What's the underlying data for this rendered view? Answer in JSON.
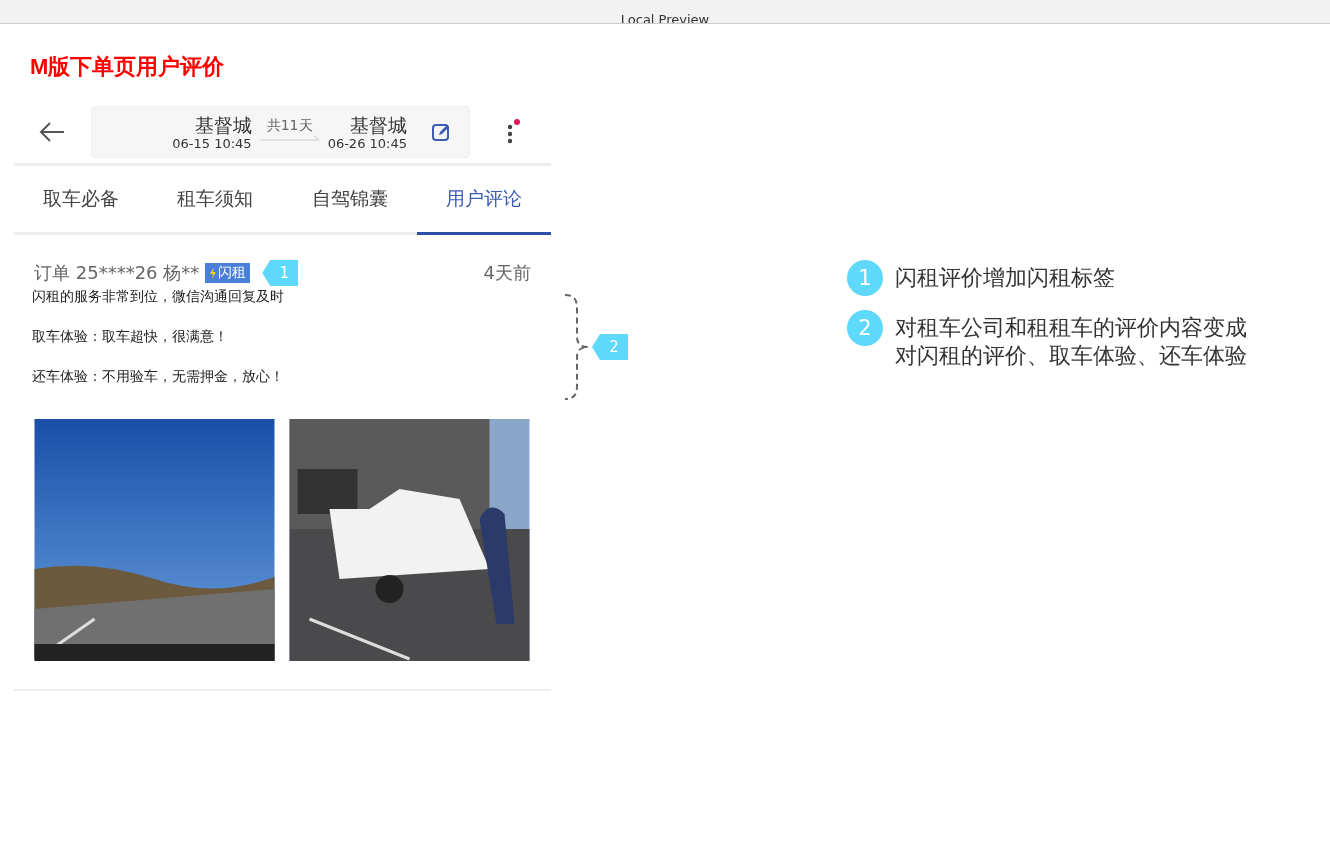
{
  "window": {
    "title": "Local Preview"
  },
  "heading": "M版下单页用户评价",
  "trip": {
    "pickup_city": "基督城",
    "pickup_time": "06-15 10:45",
    "duration": "共11天",
    "return_city": "基督城",
    "return_time": "06-26 10:45",
    "notification": true
  },
  "tabs": [
    {
      "label": "取车必备",
      "selected": false
    },
    {
      "label": "租车须知",
      "selected": false
    },
    {
      "label": "自驾锦囊",
      "selected": false
    },
    {
      "label": "用户评论",
      "selected": true
    }
  ],
  "review": {
    "order": "订单 25****26 杨**",
    "tag": "闪租",
    "time": "4天前",
    "lines": [
      "闪租的服务非常到位，微信沟通回复及时",
      "取车体验：取车超快，很满意！",
      "还车体验：不用验车，无需押金，放心！"
    ],
    "photos": [
      {
        "kind": "road"
      },
      {
        "kind": "car"
      }
    ]
  },
  "markers": [
    {
      "number": "1"
    },
    {
      "number": "2"
    }
  ],
  "notes": [
    {
      "number": "1",
      "lines": [
        "闪租评价增加闪租标签"
      ]
    },
    {
      "number": "2",
      "lines": [
        "对租车公司和租租车的评价内容变成",
        "对闪租的评价、取车体验、还车体验"
      ]
    }
  ]
}
